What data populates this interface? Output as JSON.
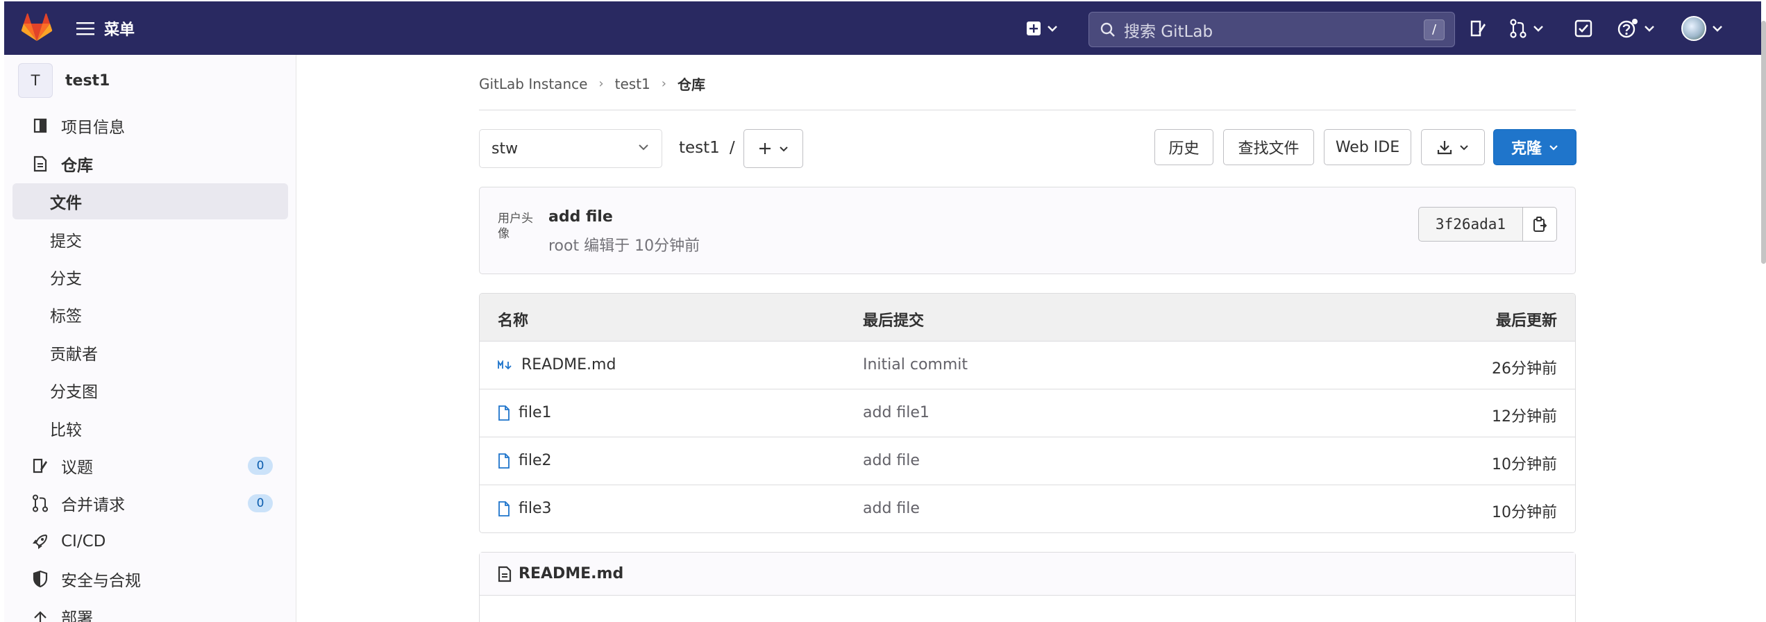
{
  "header": {
    "menu_label": "菜单",
    "search_placeholder": "搜索 GitLab",
    "search_shortcut": "/"
  },
  "sidebar": {
    "project_initial": "T",
    "project_name": "test1",
    "items": [
      {
        "label": "项目信息",
        "icon": "project-info-icon"
      },
      {
        "label": "仓库",
        "icon": "repository-icon"
      },
      {
        "label": "文件",
        "active": true
      },
      {
        "label": "提交"
      },
      {
        "label": "分支"
      },
      {
        "label": "标签"
      },
      {
        "label": "贡献者"
      },
      {
        "label": "分支图"
      },
      {
        "label": "比较"
      },
      {
        "label": "议题",
        "icon": "issues-icon",
        "badge": "0"
      },
      {
        "label": "合并请求",
        "icon": "merge-request-icon",
        "badge": "0"
      },
      {
        "label": "CI/CD",
        "icon": "rocket-icon"
      },
      {
        "label": "安全与合规",
        "icon": "shield-icon"
      },
      {
        "label": "部署",
        "icon": "deploy-icon"
      }
    ]
  },
  "breadcrumb": [
    "GitLab Instance",
    "test1",
    "仓库"
  ],
  "toolbar": {
    "branch": "stw",
    "path_root": "test1",
    "path_sep": "/",
    "history": "历史",
    "find_file": "查找文件",
    "web_ide": "Web IDE",
    "clone": "克隆"
  },
  "commit": {
    "avatar_alt": "用户头像",
    "title": "add file",
    "meta": "root 编辑于 10分钟前",
    "sha": "3f26ada1"
  },
  "file_table": {
    "headers": [
      "名称",
      "最后提交",
      "最后更新"
    ],
    "rows": [
      {
        "name": "README.md",
        "icon": "markdown-icon",
        "commit": "Initial commit",
        "updated": "26分钟前"
      },
      {
        "name": "file1",
        "icon": "file-icon",
        "commit": "add file1",
        "updated": "12分钟前"
      },
      {
        "name": "file2",
        "icon": "file-icon",
        "commit": "add file",
        "updated": "10分钟前"
      },
      {
        "name": "file3",
        "icon": "file-icon",
        "commit": "add file",
        "updated": "10分钟前"
      }
    ]
  },
  "readme": {
    "title": "README.md"
  },
  "colors": {
    "topbar": "#292961",
    "primary": "#1f75cb",
    "sidebar_active": "#e9e8ef"
  }
}
